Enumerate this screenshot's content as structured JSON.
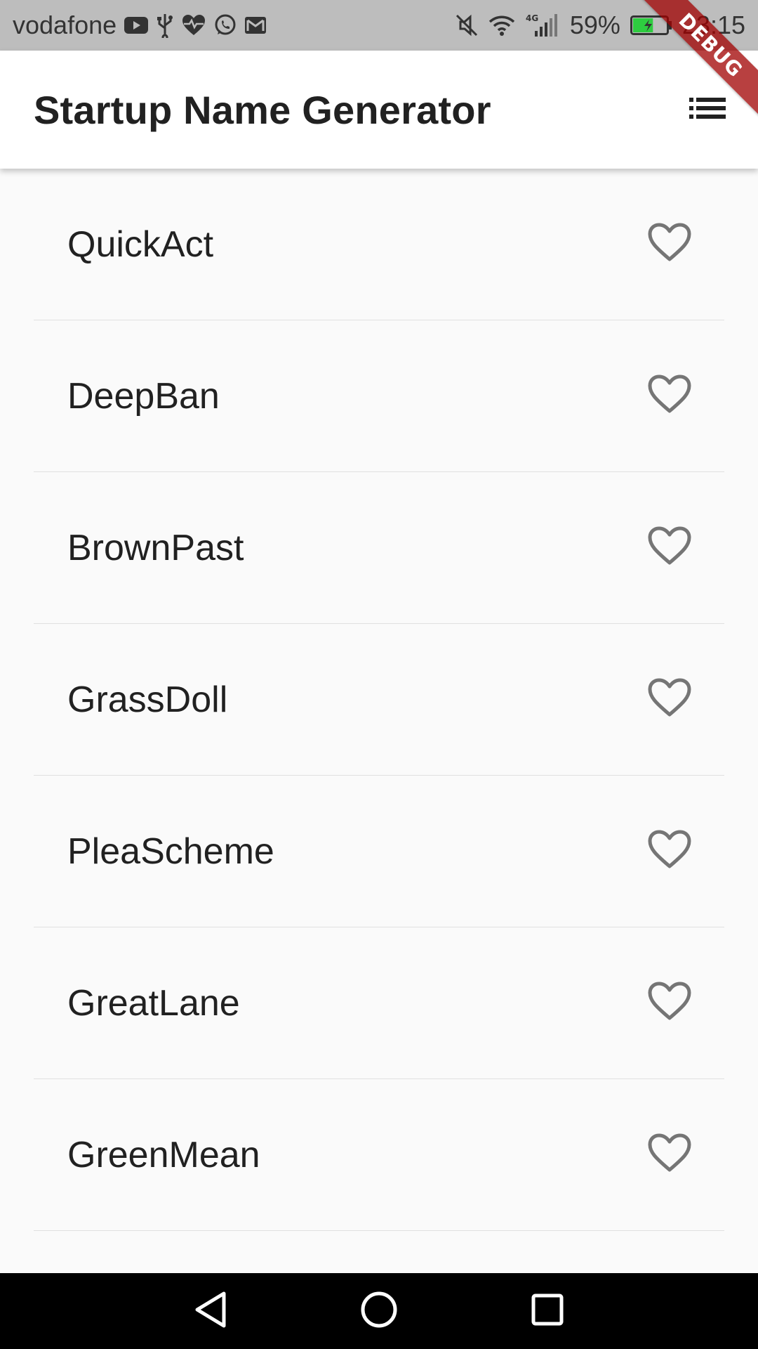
{
  "status_bar": {
    "carrier": "vodafone",
    "left_icons": [
      "youtube-icon",
      "usb-icon",
      "heart-rate-icon",
      "whatsapp-icon",
      "gmail-icon"
    ],
    "right_icons": [
      "mute-icon",
      "wifi-icon",
      "signal-4g-icon"
    ],
    "network_label": "4G",
    "battery_percent": "59%",
    "battery_level": 0.59,
    "time": "23:15"
  },
  "app_bar": {
    "title": "Startup Name Generator",
    "action_icon": "list-icon"
  },
  "debug_banner": {
    "label": "DEBUG",
    "color": "#a00000"
  },
  "list": {
    "items": [
      {
        "label": "QuickAct",
        "favorite": false
      },
      {
        "label": "DeepBan",
        "favorite": false
      },
      {
        "label": "BrownPast",
        "favorite": false
      },
      {
        "label": "GrassDoll",
        "favorite": false
      },
      {
        "label": "PleaScheme",
        "favorite": false
      },
      {
        "label": "GreatLane",
        "favorite": false
      },
      {
        "label": "GreenMean",
        "favorite": false
      }
    ],
    "favorite_icon": "heart-outline-icon",
    "icon_color": "#757575"
  },
  "nav_bar": {
    "buttons": [
      "back-icon",
      "home-icon",
      "recents-icon"
    ]
  },
  "colors": {
    "status_bar_bg": "#bdbdbd",
    "app_bar_bg": "#ffffff",
    "page_bg": "#fafafa",
    "divider": "#e0e0e0",
    "battery_fill": "#2ecc40"
  }
}
